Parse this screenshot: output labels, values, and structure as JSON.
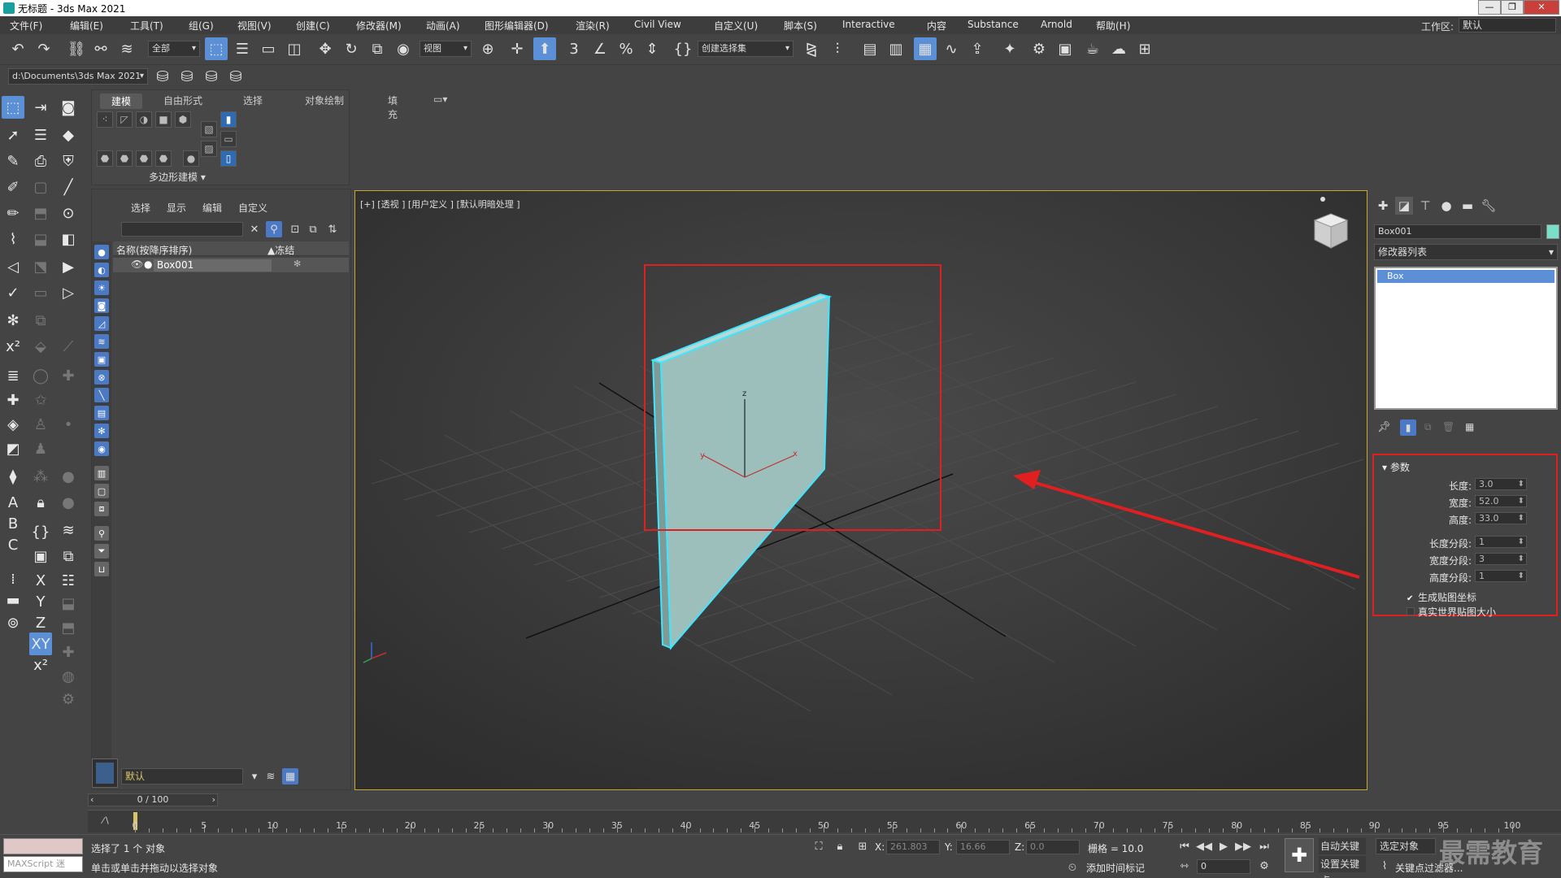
{
  "window": {
    "title": "无标题 - 3ds Max 2021"
  },
  "menu": {
    "items": [
      "文件(F)",
      "编辑(E)",
      "工具(T)",
      "组(G)",
      "视图(V)",
      "创建(C)",
      "修改器(M)",
      "动画(A)",
      "图形编辑器(D)",
      "渲染(R)",
      "Civil View",
      "自定义(U)",
      "脚本(S)",
      "Interactive",
      "内容",
      "Substance",
      "Arnold",
      "帮助(H)"
    ],
    "workspace_label": "工作区:",
    "workspace_value": "默认"
  },
  "toolbar": {
    "filter_value": "全部",
    "refcoord_value": "视图",
    "selset_value": "创建选择集"
  },
  "project": {
    "path": "d:\\Documents\\3ds Max 2021"
  },
  "ribbon": {
    "tabs": [
      "建模",
      "自由形式",
      "选择",
      "对象绘制",
      "填充"
    ],
    "footer": "多边形建模 ▾"
  },
  "explorer": {
    "menu": [
      "选择",
      "显示",
      "编辑",
      "自定义"
    ],
    "col_name": "名称(按降序排序)",
    "col_frozen": "▲冻结",
    "rows": [
      {
        "name": "Box001"
      }
    ],
    "layer_value": "默认"
  },
  "viewport": {
    "label": "[+] [透视 ] [用户定义 ] [默认明暗处理 ]",
    "axis_x": "x",
    "axis_y": "y",
    "axis_z": "z"
  },
  "command_panel": {
    "object_name": "Box001",
    "object_color": "#78e0c8",
    "modifier_list": "修改器列表",
    "stack_item": "Box",
    "params": {
      "title": "参数",
      "length_label": "长度:",
      "length": "3.0",
      "width_label": "宽度:",
      "width": "52.0",
      "height_label": "高度:",
      "height": "33.0",
      "length_seg_label": "长度分段:",
      "length_seg": "1",
      "width_seg_label": "宽度分段:",
      "width_seg": "3",
      "height_seg_label": "高度分段:",
      "height_seg": "1",
      "gen_uv": "生成贴图坐标",
      "real_world": "真实世界贴图大小"
    }
  },
  "timeline": {
    "frame": "0 / 100",
    "ticks": [
      "0",
      "5",
      "10",
      "15",
      "20",
      "25",
      "30",
      "35",
      "40",
      "45",
      "50",
      "55",
      "60",
      "65",
      "70",
      "75",
      "80",
      "85",
      "90",
      "95",
      "100"
    ]
  },
  "status": {
    "maxscript_placeholder": "MAXScript 迷",
    "selected": "选择了 1 个 对象",
    "prompt": "单击或单击并拖动以选择对象",
    "x_label": "X:",
    "x": "261.803",
    "y_label": "Y:",
    "y": "16.66",
    "z_label": "Z:",
    "z": "0.0",
    "grid": "栅格 = 10.0",
    "add_time_tag": "添加时间标记",
    "auto_key": "自动关键点",
    "set_key": "设置关键点",
    "selected_obj": "选定对象",
    "key_filter": "关键点过滤器...",
    "frame_spinner": "0"
  },
  "watermark": "最需教育",
  "colors": {
    "accent": "#5b8fd6",
    "highlight": "#e02020",
    "viewport_border": "#c7a632"
  }
}
